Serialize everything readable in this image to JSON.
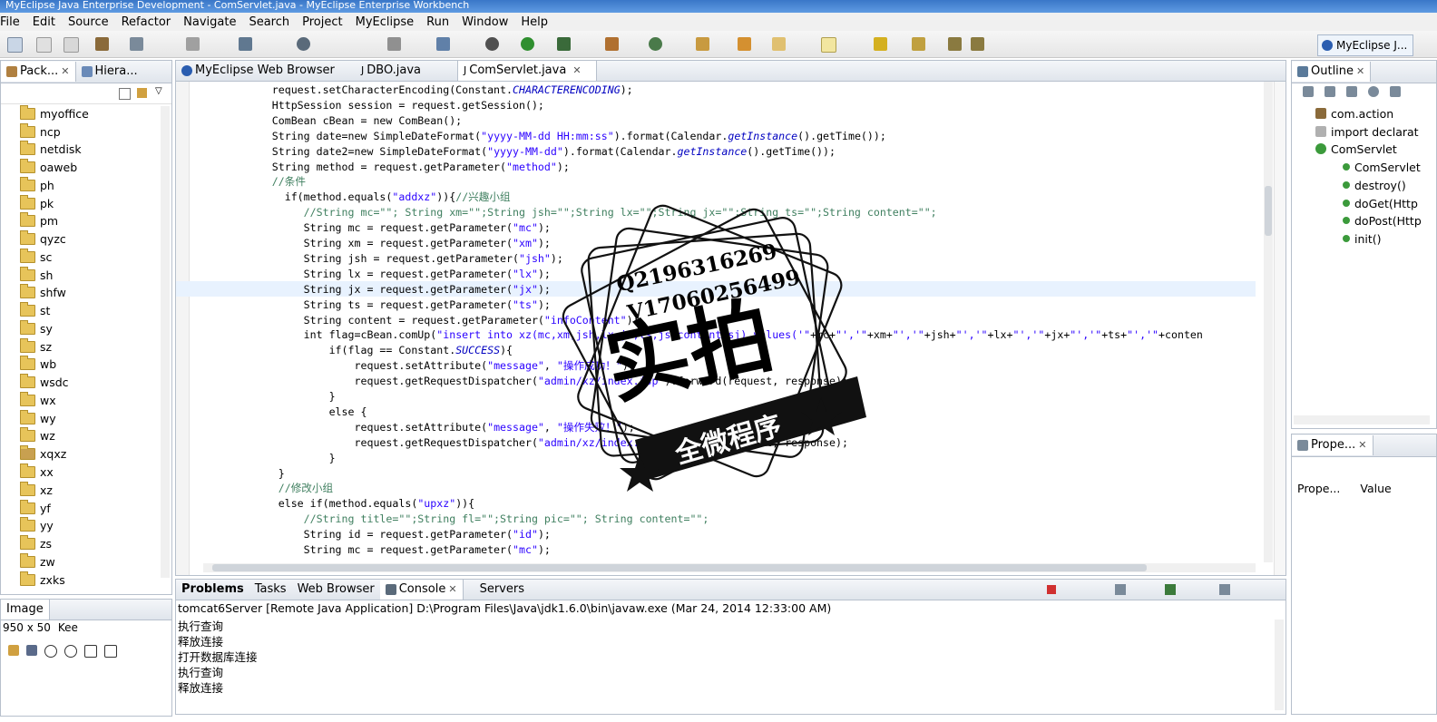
{
  "window": {
    "title": "MyEclipse Java Enterprise Development - ComServlet.java - MyEclipse Enterprise Workbench"
  },
  "menu": [
    "File",
    "Edit",
    "Source",
    "Refactor",
    "Navigate",
    "Search",
    "Project",
    "MyEclipse",
    "Run",
    "Window",
    "Help"
  ],
  "perspective": {
    "label": "MyEclipse J..."
  },
  "left_tabs": [
    "Pack...",
    "Hiera..."
  ],
  "tree": [
    "myoffice",
    "ncp",
    "netdisk",
    "oaweb",
    "ph",
    "pk",
    "pm",
    "qyzc",
    "sc",
    "sh",
    "shfw",
    "st",
    "sy",
    "sz",
    "wb",
    "wsdc",
    "wx",
    "wy",
    "wz",
    "xqxz",
    "xx",
    "xz",
    "yf",
    "yy",
    "zs",
    "zw",
    "zxks"
  ],
  "image_panel": {
    "tab": "Image",
    "size": "950 x 50",
    "zoom": "Kee"
  },
  "editor_tabs": [
    "MyEclipse Web Browser",
    "DBO.java",
    "ComServlet.java"
  ],
  "code": [
    [
      {
        "t": "            request.setCharacterEncoding(Constant.",
        "c": "k"
      },
      {
        "t": "CHARACTERENCODING",
        "c": "i"
      },
      {
        "t": ");",
        "c": "k"
      }
    ],
    [
      {
        "t": "            HttpSession session = request.getSession();",
        "c": "k"
      }
    ],
    [
      {
        "t": "            ComBean cBean = new ComBean();",
        "c": "k"
      }
    ],
    [
      {
        "t": "            String date=new SimpleDateFormat(",
        "c": "k"
      },
      {
        "t": "\"yyyy-MM-dd HH:mm:ss\"",
        "c": "s"
      },
      {
        "t": ").format(Calendar.",
        "c": "k"
      },
      {
        "t": "getInstance",
        "c": "i"
      },
      {
        "t": "().getTime());",
        "c": "k"
      }
    ],
    [
      {
        "t": "            String date2=new SimpleDateFormat(",
        "c": "k"
      },
      {
        "t": "\"yyyy-MM-dd\"",
        "c": "s"
      },
      {
        "t": ").format(Calendar.",
        "c": "k"
      },
      {
        "t": "getInstance",
        "c": "i"
      },
      {
        "t": "().getTime());",
        "c": "k"
      }
    ],
    [
      {
        "t": "            String method = request.getParameter(",
        "c": "k"
      },
      {
        "t": "\"method\"",
        "c": "s"
      },
      {
        "t": ");",
        "c": "k"
      }
    ],
    [
      {
        "t": "            //条件",
        "c": "c"
      }
    ],
    [
      {
        "t": "              if(method.equals(",
        "c": "k"
      },
      {
        "t": "\"addxz\"",
        "c": "s"
      },
      {
        "t": ")){",
        "c": "k"
      },
      {
        "t": "//兴趣小组",
        "c": "c"
      }
    ],
    [
      {
        "t": "                 //String mc=\"\"; String xm=\"\";String jsh=\"\";String lx=\"\";String jx=\"\";String ts=\"\";String content=\"\";",
        "c": "c"
      }
    ],
    [
      {
        "t": "                 String mc = request.getParameter(",
        "c": "k"
      },
      {
        "t": "\"mc\"",
        "c": "s"
      },
      {
        "t": ");",
        "c": "k"
      }
    ],
    [
      {
        "t": "                 String xm = request.getParameter(",
        "c": "k"
      },
      {
        "t": "\"xm\"",
        "c": "s"
      },
      {
        "t": ");",
        "c": "k"
      }
    ],
    [
      {
        "t": "                 String jsh = request.getParameter(",
        "c": "k"
      },
      {
        "t": "\"jsh\"",
        "c": "s"
      },
      {
        "t": ");",
        "c": "k"
      }
    ],
    [
      {
        "t": "                 String lx = request.getParameter(",
        "c": "k"
      },
      {
        "t": "\"lx\"",
        "c": "s"
      },
      {
        "t": ");",
        "c": "k"
      }
    ],
    [
      {
        "t": "                 String jx = request.getParameter(",
        "c": "k"
      },
      {
        "t": "\"jx\"",
        "c": "s"
      },
      {
        "t": ");",
        "c": "k"
      }
    ],
    [
      {
        "t": "                 String ts = request.getParameter(",
        "c": "k"
      },
      {
        "t": "\"ts\"",
        "c": "s"
      },
      {
        "t": ");",
        "c": "k"
      }
    ],
    [
      {
        "t": "                 String content = request.getParameter(",
        "c": "k"
      },
      {
        "t": "\"infoContent\"",
        "c": "s"
      },
      {
        "t": ");",
        "c": "k"
      }
    ],
    [
      {
        "t": "                 int flag=cBean.comUp(",
        "c": "k"
      },
      {
        "t": "\"insert into xz(mc,xm,jsh,lx,jx,ts,js,content,sj) values('\"",
        "c": "s"
      },
      {
        "t": "+mc+",
        "c": "k"
      },
      {
        "t": "\"','\"",
        "c": "s"
      },
      {
        "t": "+xm+",
        "c": "k"
      },
      {
        "t": "\"','\"",
        "c": "s"
      },
      {
        "t": "+jsh+",
        "c": "k"
      },
      {
        "t": "\"','\"",
        "c": "s"
      },
      {
        "t": "+lx+",
        "c": "k"
      },
      {
        "t": "\"','\"",
        "c": "s"
      },
      {
        "t": "+jx+",
        "c": "k"
      },
      {
        "t": "\"','\"",
        "c": "s"
      },
      {
        "t": "+ts+",
        "c": "k"
      },
      {
        "t": "\"','\"",
        "c": "s"
      },
      {
        "t": "+conten",
        "c": "k"
      }
    ],
    [
      {
        "t": "                     if(flag == Constant.",
        "c": "k"
      },
      {
        "t": "SUCCESS",
        "c": "i"
      },
      {
        "t": "){",
        "c": "k"
      }
    ],
    [
      {
        "t": "                         request.setAttribute(",
        "c": "k"
      },
      {
        "t": "\"message\"",
        "c": "s"
      },
      {
        "t": ", ",
        "c": "k"
      },
      {
        "t": "\"操作成功！\"",
        "c": "s"
      },
      {
        "t": ");",
        "c": "k"
      }
    ],
    [
      {
        "t": "                         request.getRequestDispatcher(",
        "c": "k"
      },
      {
        "t": "\"admin/xz/index.jsp\"",
        "c": "s"
      },
      {
        "t": ").forward(request, response);",
        "c": "k"
      }
    ],
    [
      {
        "t": "                     }",
        "c": "k"
      }
    ],
    [
      {
        "t": "                     else {",
        "c": "k"
      }
    ],
    [
      {
        "t": "                         request.setAttribute(",
        "c": "k"
      },
      {
        "t": "\"message\"",
        "c": "s"
      },
      {
        "t": ", ",
        "c": "k"
      },
      {
        "t": "\"操作失败！\"",
        "c": "s"
      },
      {
        "t": ");",
        "c": "k"
      }
    ],
    [
      {
        "t": "                         request.getRequestDispatcher(",
        "c": "k"
      },
      {
        "t": "\"admin/xz/index.jsp\"",
        "c": "s"
      },
      {
        "t": ").forward(request, response);",
        "c": "k"
      }
    ],
    [
      {
        "t": "                     }",
        "c": "k"
      }
    ],
    [
      {
        "t": "             }",
        "c": "k"
      }
    ],
    [
      {
        "t": "             //修改小组",
        "c": "c"
      }
    ],
    [
      {
        "t": "             else if(method.equals(",
        "c": "k"
      },
      {
        "t": "\"upxz\"",
        "c": "s"
      },
      {
        "t": ")){",
        "c": "k"
      }
    ],
    [
      {
        "t": "                 //String title=\"\";String fl=\"\";String pic=\"\"; String content=\"\";",
        "c": "c"
      }
    ],
    [
      {
        "t": "                 String id = request.getParameter(",
        "c": "k"
      },
      {
        "t": "\"id\"",
        "c": "s"
      },
      {
        "t": ");",
        "c": "k"
      }
    ],
    [
      {
        "t": "                 String mc = request.getParameter(",
        "c": "k"
      },
      {
        "t": "\"mc\"",
        "c": "s"
      },
      {
        "t": ");",
        "c": "k"
      }
    ]
  ],
  "outline": {
    "tab": "Outline",
    "items": [
      "com.action",
      "import declarat",
      "ComServlet",
      "ComServlet",
      "destroy()",
      "doGet(Http",
      "doPost(Http",
      "init()"
    ]
  },
  "properties": {
    "tab": "Prope...",
    "col1": "Prope...",
    "col2": "Value"
  },
  "bottom_tabs": [
    "Problems",
    "Tasks",
    "Web Browser",
    "Console",
    "Servers"
  ],
  "console": {
    "header": "tomcat6Server [Remote Java Application] D:\\Program Files\\Java\\jdk1.6.0\\bin\\javaw.exe (Mar 24, 2014 12:33:00 AM)",
    "lines": [
      "执行查询",
      "释放连接",
      "打开数据库连接",
      "执行查询",
      "释放连接"
    ]
  },
  "watermark": {
    "qq": "Q2196316269",
    "v": "V17060256499",
    "big": "实拍",
    "banner": "全微程序"
  },
  "colors": {
    "string": "#2a00ff",
    "comment": "#3f7f5f",
    "field": "#0000c0",
    "tab_active": "#ffffff"
  }
}
